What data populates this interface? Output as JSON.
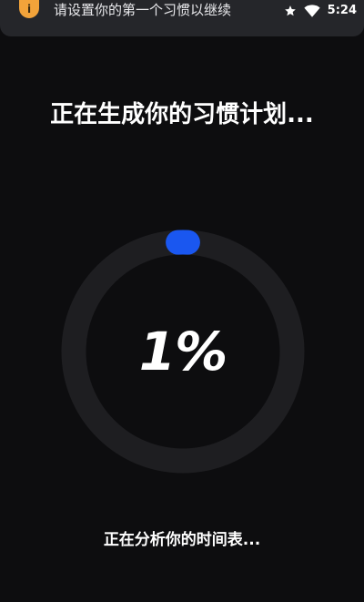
{
  "status_bar": {
    "notification_icon": "info-icon",
    "notification_text": "请设置你的第一个习惯以继续",
    "icons": [
      "star-icon",
      "wifi-icon"
    ],
    "time": "5:24"
  },
  "main": {
    "title": "正在生成你的习惯计划...",
    "progress_value": 0.01,
    "progress_text": "1%",
    "subtitle": "正在分析你的时间表..."
  },
  "colors": {
    "background": "#0d0d0f",
    "ring_track": "#1e1e21",
    "ring_progress": "#1a57f0",
    "notification_accent": "#f2a33a"
  }
}
